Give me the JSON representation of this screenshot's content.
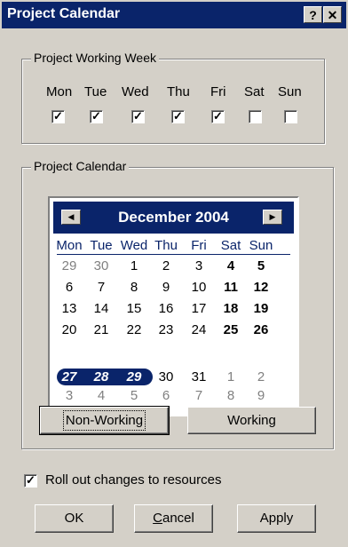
{
  "window": {
    "title": "Project Calendar",
    "help_label": "?",
    "close_label": "✕"
  },
  "working_week": {
    "legend": "Project Working Week",
    "days": [
      {
        "label": "Mon",
        "checked": true
      },
      {
        "label": "Tue",
        "checked": true
      },
      {
        "label": "Wed",
        "checked": true
      },
      {
        "label": "Thu",
        "checked": true
      },
      {
        "label": "Fri",
        "checked": true
      },
      {
        "label": "Sat",
        "checked": false
      },
      {
        "label": "Sun",
        "checked": false
      }
    ]
  },
  "calendar": {
    "legend": "Project Calendar",
    "month_label": "December 2004",
    "prev_icon": "prev-month-icon",
    "next_icon": "next-month-icon",
    "weekday_headers": [
      "Mon",
      "Tue",
      "Wed",
      "Thu",
      "Fri",
      "Sat",
      "Sun"
    ],
    "weeks": [
      [
        "29",
        "30",
        "1",
        "2",
        "3",
        "4",
        "5"
      ],
      [
        "6",
        "7",
        "8",
        "9",
        "10",
        "11",
        "12"
      ],
      [
        "13",
        "14",
        "15",
        "16",
        "17",
        "18",
        "19"
      ],
      [
        "20",
        "21",
        "22",
        "23",
        "24",
        "25",
        "26"
      ],
      [
        "27",
        "28",
        "29",
        "30",
        "31",
        "1",
        "2"
      ],
      [
        "3",
        "4",
        "5",
        "6",
        "7",
        "8",
        "9"
      ]
    ],
    "selected_days": [
      "27",
      "28",
      "29"
    ],
    "colors": {
      "header": "#0a246a",
      "other_month": "#808080"
    }
  },
  "buttons": {
    "non_working": "Non-Working",
    "working": "Working",
    "ok": "OK",
    "cancel_first": "C",
    "cancel_rest": "ancel",
    "apply": "Apply"
  },
  "rollout": {
    "label": "Roll out changes to resources",
    "checked": true
  }
}
